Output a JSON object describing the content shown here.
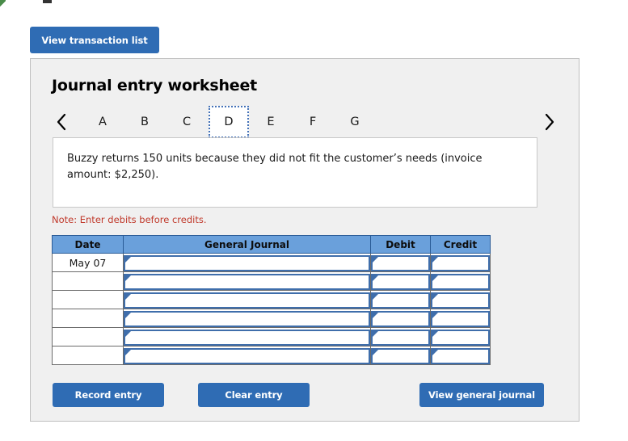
{
  "top_bar": {
    "view_transaction_list_label": "View transaction list"
  },
  "worksheet": {
    "title": "Journal entry worksheet",
    "tabs": [
      {
        "label": "A",
        "selected": false
      },
      {
        "label": "B",
        "selected": false
      },
      {
        "label": "C",
        "selected": false
      },
      {
        "label": "D",
        "selected": true
      },
      {
        "label": "E",
        "selected": false
      },
      {
        "label": "F",
        "selected": false
      },
      {
        "label": "G",
        "selected": false
      }
    ],
    "nav": {
      "prev_icon": "chevron-left-icon",
      "next_icon": "chevron-right-icon"
    },
    "description": "Buzzy returns 150 units because they did not fit the customer’s needs (invoice amount: $2,250).",
    "note": "Note: Enter debits before credits.",
    "table": {
      "headers": [
        "Date",
        "General Journal",
        "Debit",
        "Credit"
      ],
      "rows": [
        {
          "date": "May 07",
          "journal": "",
          "debit": "",
          "credit": ""
        },
        {
          "date": "",
          "journal": "",
          "debit": "",
          "credit": ""
        },
        {
          "date": "",
          "journal": "",
          "debit": "",
          "credit": ""
        },
        {
          "date": "",
          "journal": "",
          "debit": "",
          "credit": ""
        },
        {
          "date": "",
          "journal": "",
          "debit": "",
          "credit": ""
        },
        {
          "date": "",
          "journal": "",
          "debit": "",
          "credit": ""
        }
      ]
    },
    "actions": {
      "record_entry_label": "Record entry",
      "clear_entry_label": "Clear entry",
      "view_general_journal_label": "View general journal"
    }
  },
  "colors": {
    "button_blue": "#2f6cb4",
    "table_header_blue": "#6aa0db",
    "field_border_blue": "#3f6eab",
    "note_red": "#c0392b",
    "panel_gray": "#f0f0f0"
  }
}
